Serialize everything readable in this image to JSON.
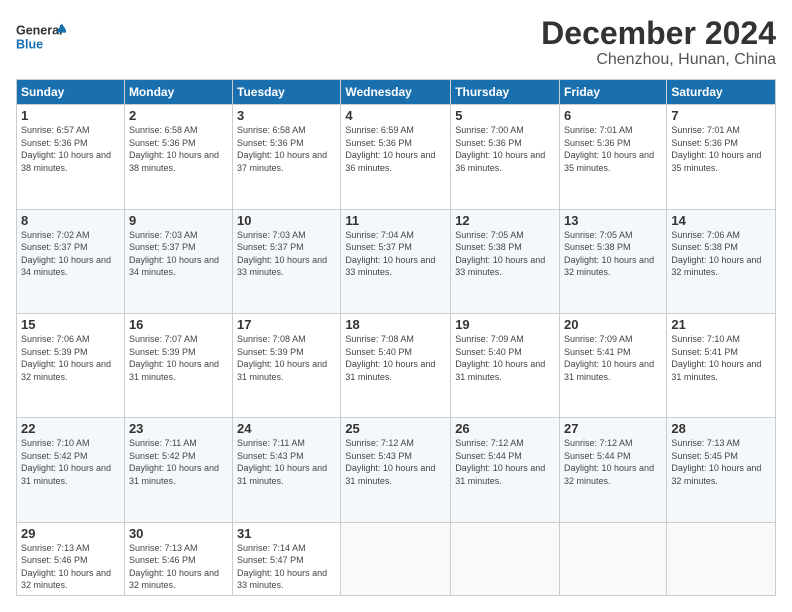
{
  "logo": {
    "line1": "General",
    "line2": "Blue"
  },
  "title": "December 2024",
  "subtitle": "Chenzhou, Hunan, China",
  "days_header": [
    "Sunday",
    "Monday",
    "Tuesday",
    "Wednesday",
    "Thursday",
    "Friday",
    "Saturday"
  ],
  "weeks": [
    [
      {
        "day": "1",
        "sunrise": "6:57 AM",
        "sunset": "5:36 PM",
        "daylight": "10 hours and 38 minutes."
      },
      {
        "day": "2",
        "sunrise": "6:58 AM",
        "sunset": "5:36 PM",
        "daylight": "10 hours and 38 minutes."
      },
      {
        "day": "3",
        "sunrise": "6:58 AM",
        "sunset": "5:36 PM",
        "daylight": "10 hours and 37 minutes."
      },
      {
        "day": "4",
        "sunrise": "6:59 AM",
        "sunset": "5:36 PM",
        "daylight": "10 hours and 36 minutes."
      },
      {
        "day": "5",
        "sunrise": "7:00 AM",
        "sunset": "5:36 PM",
        "daylight": "10 hours and 36 minutes."
      },
      {
        "day": "6",
        "sunrise": "7:01 AM",
        "sunset": "5:36 PM",
        "daylight": "10 hours and 35 minutes."
      },
      {
        "day": "7",
        "sunrise": "7:01 AM",
        "sunset": "5:36 PM",
        "daylight": "10 hours and 35 minutes."
      }
    ],
    [
      {
        "day": "8",
        "sunrise": "7:02 AM",
        "sunset": "5:37 PM",
        "daylight": "10 hours and 34 minutes."
      },
      {
        "day": "9",
        "sunrise": "7:03 AM",
        "sunset": "5:37 PM",
        "daylight": "10 hours and 34 minutes."
      },
      {
        "day": "10",
        "sunrise": "7:03 AM",
        "sunset": "5:37 PM",
        "daylight": "10 hours and 33 minutes."
      },
      {
        "day": "11",
        "sunrise": "7:04 AM",
        "sunset": "5:37 PM",
        "daylight": "10 hours and 33 minutes."
      },
      {
        "day": "12",
        "sunrise": "7:05 AM",
        "sunset": "5:38 PM",
        "daylight": "10 hours and 33 minutes."
      },
      {
        "day": "13",
        "sunrise": "7:05 AM",
        "sunset": "5:38 PM",
        "daylight": "10 hours and 32 minutes."
      },
      {
        "day": "14",
        "sunrise": "7:06 AM",
        "sunset": "5:38 PM",
        "daylight": "10 hours and 32 minutes."
      }
    ],
    [
      {
        "day": "15",
        "sunrise": "7:06 AM",
        "sunset": "5:39 PM",
        "daylight": "10 hours and 32 minutes."
      },
      {
        "day": "16",
        "sunrise": "7:07 AM",
        "sunset": "5:39 PM",
        "daylight": "10 hours and 31 minutes."
      },
      {
        "day": "17",
        "sunrise": "7:08 AM",
        "sunset": "5:39 PM",
        "daylight": "10 hours and 31 minutes."
      },
      {
        "day": "18",
        "sunrise": "7:08 AM",
        "sunset": "5:40 PM",
        "daylight": "10 hours and 31 minutes."
      },
      {
        "day": "19",
        "sunrise": "7:09 AM",
        "sunset": "5:40 PM",
        "daylight": "10 hours and 31 minutes."
      },
      {
        "day": "20",
        "sunrise": "7:09 AM",
        "sunset": "5:41 PM",
        "daylight": "10 hours and 31 minutes."
      },
      {
        "day": "21",
        "sunrise": "7:10 AM",
        "sunset": "5:41 PM",
        "daylight": "10 hours and 31 minutes."
      }
    ],
    [
      {
        "day": "22",
        "sunrise": "7:10 AM",
        "sunset": "5:42 PM",
        "daylight": "10 hours and 31 minutes."
      },
      {
        "day": "23",
        "sunrise": "7:11 AM",
        "sunset": "5:42 PM",
        "daylight": "10 hours and 31 minutes."
      },
      {
        "day": "24",
        "sunrise": "7:11 AM",
        "sunset": "5:43 PM",
        "daylight": "10 hours and 31 minutes."
      },
      {
        "day": "25",
        "sunrise": "7:12 AM",
        "sunset": "5:43 PM",
        "daylight": "10 hours and 31 minutes."
      },
      {
        "day": "26",
        "sunrise": "7:12 AM",
        "sunset": "5:44 PM",
        "daylight": "10 hours and 31 minutes."
      },
      {
        "day": "27",
        "sunrise": "7:12 AM",
        "sunset": "5:44 PM",
        "daylight": "10 hours and 32 minutes."
      },
      {
        "day": "28",
        "sunrise": "7:13 AM",
        "sunset": "5:45 PM",
        "daylight": "10 hours and 32 minutes."
      }
    ],
    [
      {
        "day": "29",
        "sunrise": "7:13 AM",
        "sunset": "5:46 PM",
        "daylight": "10 hours and 32 minutes."
      },
      {
        "day": "30",
        "sunrise": "7:13 AM",
        "sunset": "5:46 PM",
        "daylight": "10 hours and 32 minutes."
      },
      {
        "day": "31",
        "sunrise": "7:14 AM",
        "sunset": "5:47 PM",
        "daylight": "10 hours and 33 minutes."
      },
      null,
      null,
      null,
      null
    ]
  ]
}
